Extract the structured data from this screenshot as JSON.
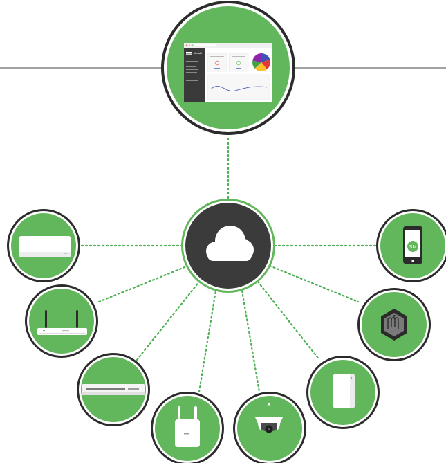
{
  "colors": {
    "green": "#62b65b",
    "ring": "#2b2b2b",
    "cloud_bg": "#3b3b3b",
    "line": "#6b6b6b",
    "dots": "#4caf50"
  },
  "dashboard": {
    "brand": "Meraki",
    "pie_colors": [
      "#3f51b5",
      "#e53935",
      "#fbc02d",
      "#43a047",
      "#8e24aa"
    ]
  },
  "devices": {
    "left": [
      "access-point-device",
      "security-appliance-device",
      "switch-device",
      "cellular-gateway-device"
    ],
    "right": [
      "systems-manager-device",
      "sensor-hub-device",
      "sensor-device",
      "camera-device"
    ]
  },
  "phone_label": "SM"
}
